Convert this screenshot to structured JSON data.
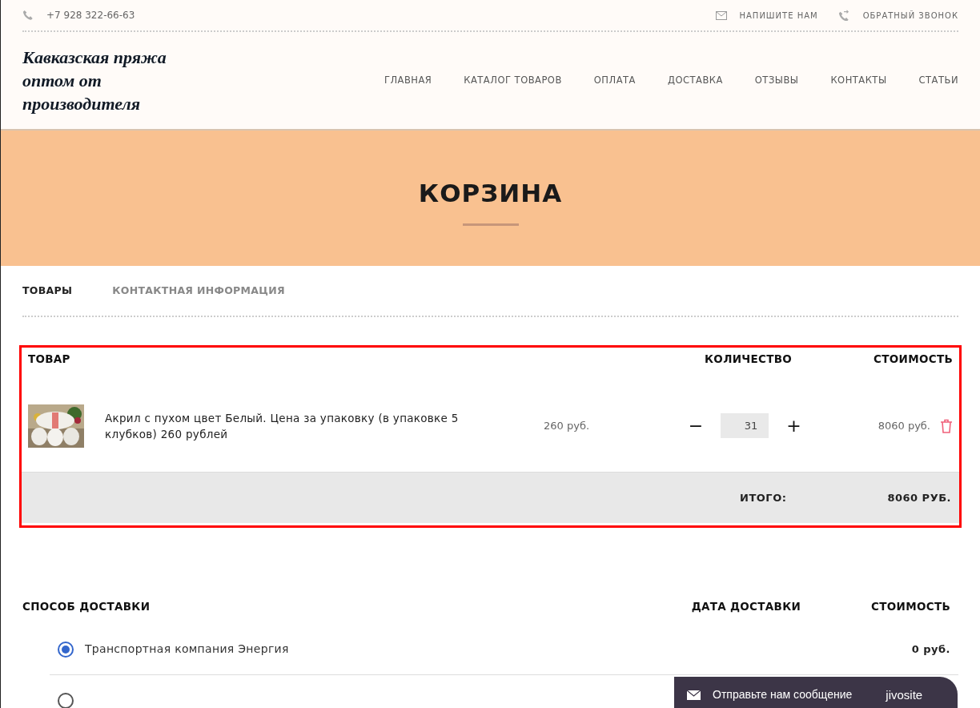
{
  "topbar": {
    "phone": "+7 928 322-66-63",
    "links": [
      "НАПИШИТЕ НАМ",
      "ОБРАТНЫЙ ЗВОНОК"
    ]
  },
  "logo": "Кавказская пряжа оптом от производителя",
  "nav": [
    "ГЛАВНАЯ",
    "КАТАЛОГ ТОВАРОВ",
    "ОПЛАТА",
    "ДОСТАВКА",
    "ОТЗЫВЫ",
    "КОНТАКТЫ",
    "СТАТЬИ"
  ],
  "banner": {
    "title": "КОРЗИНА"
  },
  "tabs": [
    {
      "label": "ТОВАРЫ",
      "selected": true
    },
    {
      "label": "КОНТАКТНАЯ ИНФОРМАЦИЯ",
      "selected": false
    }
  ],
  "cart": {
    "columns": [
      "ТОВАР",
      "КОЛИЧЕСТВО",
      "СТОИМОСТЬ"
    ],
    "items": [
      {
        "kind": "picture",
        "decrease": "−",
        "increase": "+",
        "name": "Акрил с пухом цвет Белый. Цена за упаковку (в упаковке 5 клубков) 260 рублей",
        "price": "260 руб.",
        "quantity": "31",
        "cost": "8060 руб."
      }
    ],
    "total_label": "ИТОГО:",
    "total": "8060 РУБ."
  },
  "delivery": {
    "columns": [
      "СПОСОБ ДОСТАВКИ",
      "ДАТА ДОСТАВКИ",
      "СТОИМОСТЬ"
    ],
    "options": [
      {
        "label": "Транспортная компания Энергия",
        "cost": "0 руб.",
        "selected": true
      },
      {
        "selected": false
      }
    ]
  },
  "chat": {
    "label": "Отправьте нам сообщение",
    "brand": "jivosite"
  }
}
